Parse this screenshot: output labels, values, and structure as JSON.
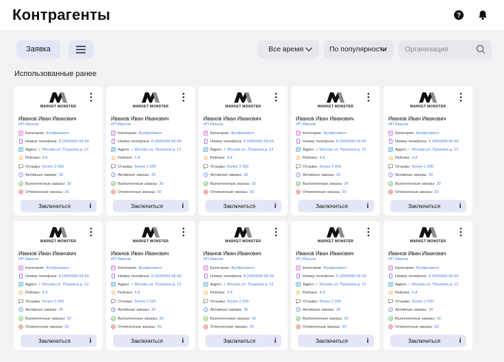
{
  "header": {
    "title": "Контрагенты",
    "help_icon": "help-circle-icon",
    "notifications_icon": "bell-icon"
  },
  "toolbar": {
    "order_button": "Заявка",
    "menu_icon": "hamburger-icon",
    "period_select": "Все время",
    "sort_select": "По популярности",
    "search_placeholder": "Организация",
    "search_value": ""
  },
  "section": {
    "title": "Использованные ранее"
  },
  "labels": {
    "category": "Категория:",
    "phone": "Номер телефона:",
    "address": "Адрес:",
    "rating": "Рейтинг:",
    "reviews": "Отзывы:",
    "active_orders": "Активные заказы:",
    "completed_orders": "Выполненные заказы:",
    "cancelled_orders": "Отмененные заказы:",
    "join_button": "Заключиться",
    "info_button": "i"
  },
  "colors": {
    "accent": "#4a7fe0",
    "button_bg": "#e3e6f6",
    "page_bg": "#f2f2f5",
    "check_green": "#3aaa3a",
    "cancel_red": "#e0453a",
    "star_orange": "#f5a623"
  },
  "cards": [
    {
      "logo": "MARKET MONSTER",
      "name": "Иванов Иван Иванович",
      "org": "ИП Иванов",
      "category": "Фулфилмент",
      "phone": "8 (999)999-99-99",
      "address": "г. Москва ул. Пушкина д. 12",
      "rating": "4.8",
      "reviews": "более 2 000",
      "active": "30",
      "completed": "30",
      "cancelled": "30"
    },
    {
      "logo": "MARKET MONSTER",
      "name": "Иванов Иван Иванович",
      "org": "ИП Иванов",
      "category": "Фулфилмент",
      "phone": "8 (999)999-99-99",
      "address": "г. Москва ул. Пушкина д. 12",
      "rating": "4.8",
      "reviews": "более 2 000",
      "active": "30",
      "completed": "30",
      "cancelled": "30"
    },
    {
      "logo": "MARKET MONSTER",
      "name": "Иванов Иван Иванович",
      "org": "ИП Иванов",
      "category": "Фулфилмент",
      "phone": "8 (999)999-99-99",
      "address": "г. Москва ул. Пушкина д. 12",
      "rating": "4.8",
      "reviews": "более 2 000",
      "active": "30",
      "completed": "30",
      "cancelled": "30"
    },
    {
      "logo": "MARKET MONSTER",
      "name": "Иванов Иван Иванович",
      "org": "ИП Иванов",
      "category": "Фулфилмент",
      "phone": "8 (999)999-99-99",
      "address": "г. Москва ул. Пушкина д. 12",
      "rating": "4.8",
      "reviews": "более 2 000",
      "active": "30",
      "completed": "30",
      "cancelled": "30"
    },
    {
      "logo": "MARKET MONSTER",
      "name": "Иванов Иван Иванович",
      "org": "ИП Иванов",
      "category": "Фулфилмент",
      "phone": "8 (999)999-99-99",
      "address": "г. Москва ул. Пушкина д. 12",
      "rating": "4.8",
      "reviews": "более 2 000",
      "active": "30",
      "completed": "30",
      "cancelled": "30"
    },
    {
      "logo": "MARKET MONSTER",
      "name": "Иванов Иван Иванович",
      "org": "ИП Иванов",
      "category": "Фулфилмент",
      "phone": "8 (999)999-99-99",
      "address": "г. Москва ул. Пушкина д. 12",
      "rating": "4.8",
      "reviews": "более 2 000",
      "active": "30",
      "completed": "30",
      "cancelled": "30"
    },
    {
      "logo": "MARKET MONSTER",
      "name": "Иванов Иван Иванович",
      "org": "ИП Иванов",
      "category": "Фулфилмент",
      "phone": "8 (999)999-99-99",
      "address": "г. Москва ул. Пушкина д. 12",
      "rating": "4.8",
      "reviews": "более 2 000",
      "active": "30",
      "completed": "30",
      "cancelled": "30"
    },
    {
      "logo": "MARKET MONSTER",
      "name": "Иванов Иван Иванович",
      "org": "ИП Иванов",
      "category": "Фулфилмент",
      "phone": "8 (999)999-99-99",
      "address": "г. Москва ул. Пушкина д. 12",
      "rating": "4.8",
      "reviews": "более 2 000",
      "active": "30",
      "completed": "30",
      "cancelled": "30"
    },
    {
      "logo": "MARKET MONSTER",
      "name": "Иванов Иван Иванович",
      "org": "ИП Иванов",
      "category": "Фулфилмент",
      "phone": "8 (999)999-99-99",
      "address": "г. Москва ул. Пушкина д. 12",
      "rating": "4.8",
      "reviews": "более 2 000",
      "active": "30",
      "completed": "30",
      "cancelled": "30"
    },
    {
      "logo": "MARKET MONSTER",
      "name": "Иванов Иван Иванович",
      "org": "ИП Иванов",
      "category": "Фулфилмент",
      "phone": "8 (999)999-99-99",
      "address": "г. Москва ул. Пушкина д. 12",
      "rating": "4.8",
      "reviews": "более 2 000",
      "active": "30",
      "completed": "30",
      "cancelled": "30"
    }
  ]
}
